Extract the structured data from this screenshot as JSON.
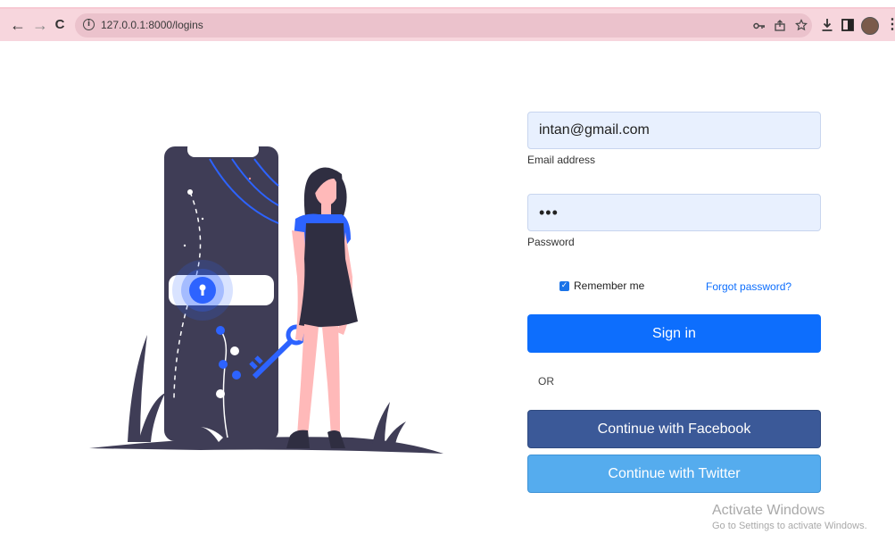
{
  "browser": {
    "url": "127.0.0.1:8000/logins",
    "back_icon": "←",
    "forward_icon": "→",
    "reload_icon": "C"
  },
  "form": {
    "email": {
      "value": "intan@gmail.com",
      "label": "Email address"
    },
    "password": {
      "value": "•••",
      "label": "Password"
    },
    "remember_label": "Remember me",
    "remember_checked": true,
    "forgot_label": "Forgot password?",
    "signin_label": "Sign in",
    "or_label": "OR",
    "facebook_label": "Continue with Facebook",
    "twitter_label": "Continue with Twitter"
  },
  "colors": {
    "primary": "#0d6efd",
    "facebook": "#3b5998",
    "twitter": "#55acee",
    "toolbar": "#f7d6dd",
    "input_bg": "#e8f0fe"
  },
  "watermark": {
    "title": "Activate Windows",
    "subtitle": "Go to Settings to activate Windows."
  }
}
